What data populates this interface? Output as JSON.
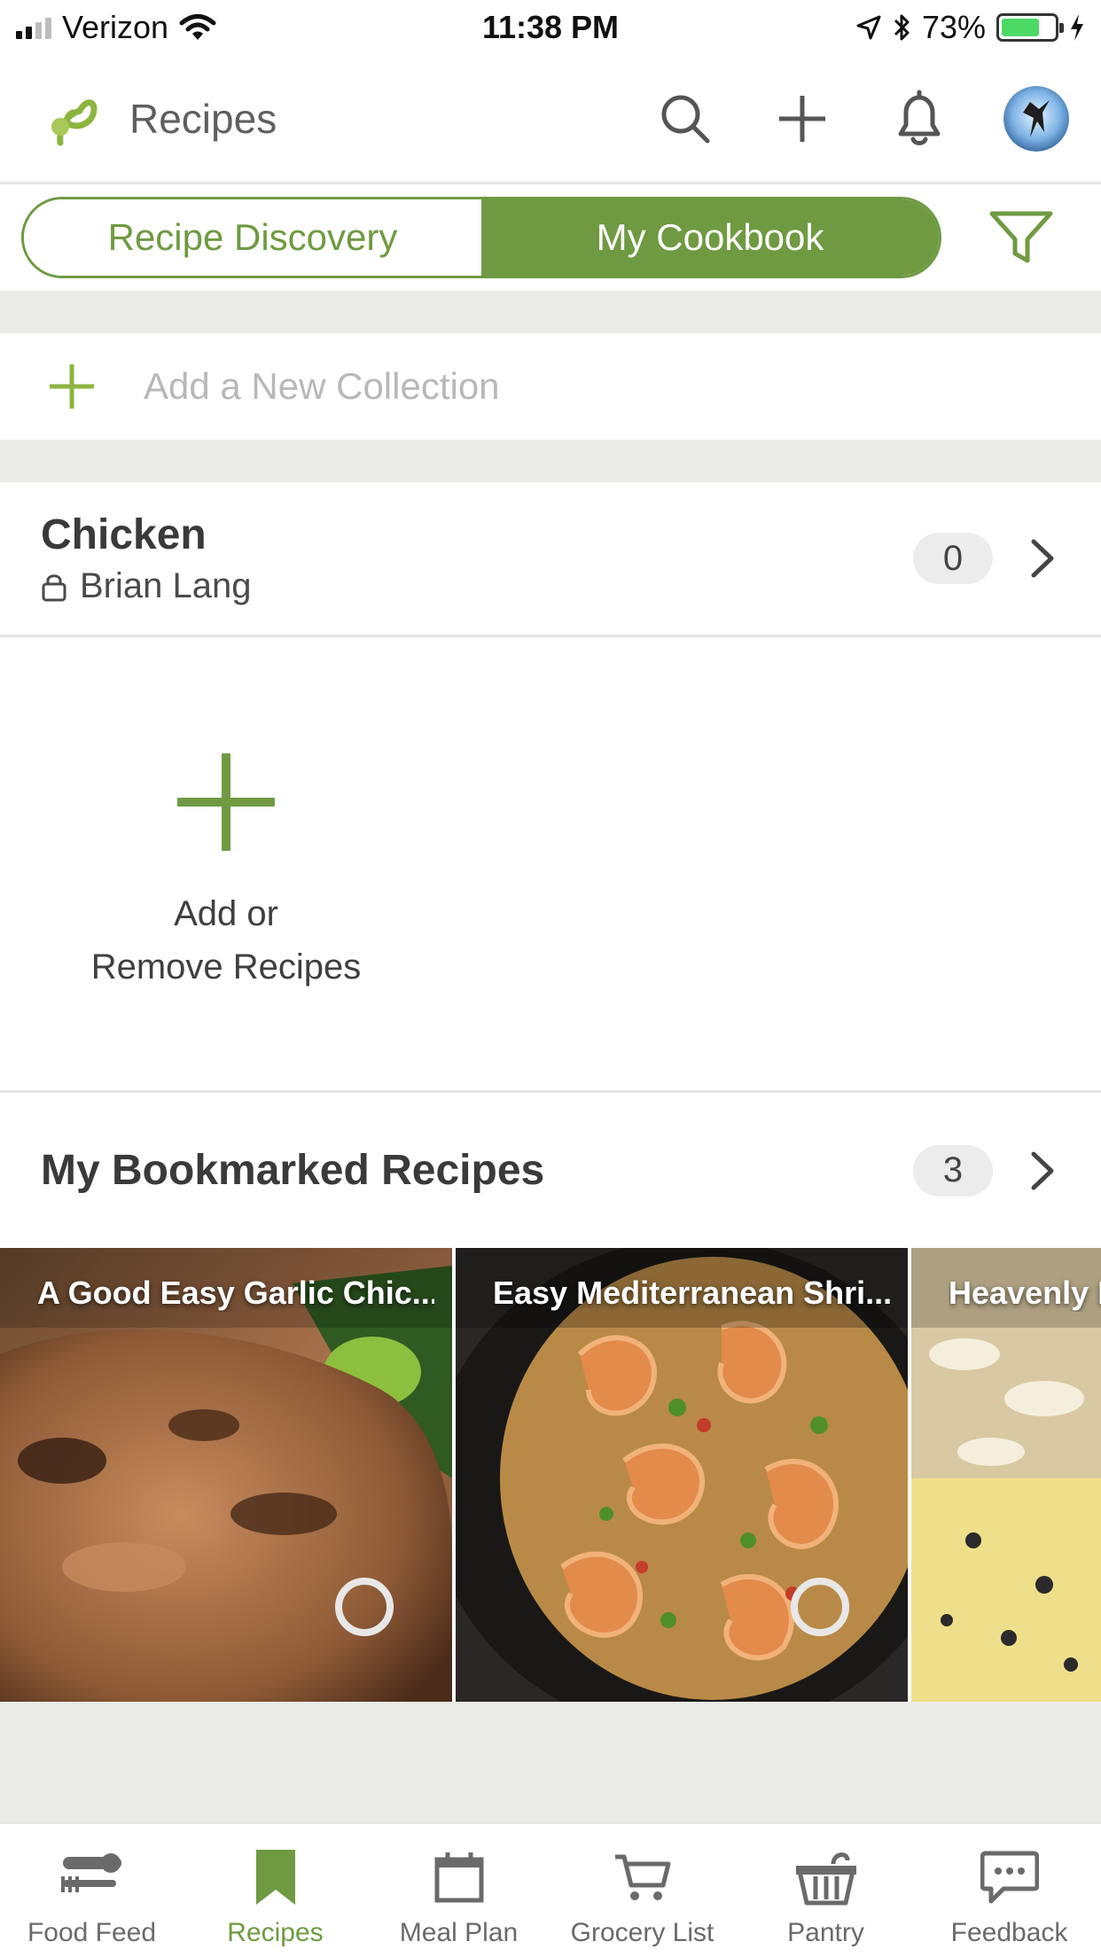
{
  "status_bar": {
    "carrier": "Verizon",
    "time": "11:38 PM",
    "battery_pct": "73%",
    "battery_level": 0.73
  },
  "header": {
    "title": "Recipes",
    "icons": [
      "search-icon",
      "plus-icon",
      "bell-icon",
      "avatar"
    ]
  },
  "segmented": {
    "options": [
      "Recipe Discovery",
      "My Cookbook"
    ],
    "selected": "My Cookbook"
  },
  "add_collection": {
    "placeholder": "Add a New Collection"
  },
  "collections": [
    {
      "title": "Chicken",
      "owner": "Brian Lang",
      "count": "0",
      "empty_action_line1": "Add or",
      "empty_action_line2": "Remove Recipes"
    },
    {
      "title": "My Bookmarked Recipes",
      "count": "3",
      "recipes": [
        "A Good Easy Garlic Chic...",
        "Easy Mediterranean Shri...",
        "Heavenly H"
      ]
    }
  ],
  "tab_bar": {
    "items": [
      "Food Feed",
      "Recipes",
      "Meal Plan",
      "Grocery List",
      "Pantry",
      "Feedback"
    ],
    "active": "Recipes"
  },
  "colors": {
    "accent": "#6f9a42",
    "band": "#eaeae6"
  }
}
